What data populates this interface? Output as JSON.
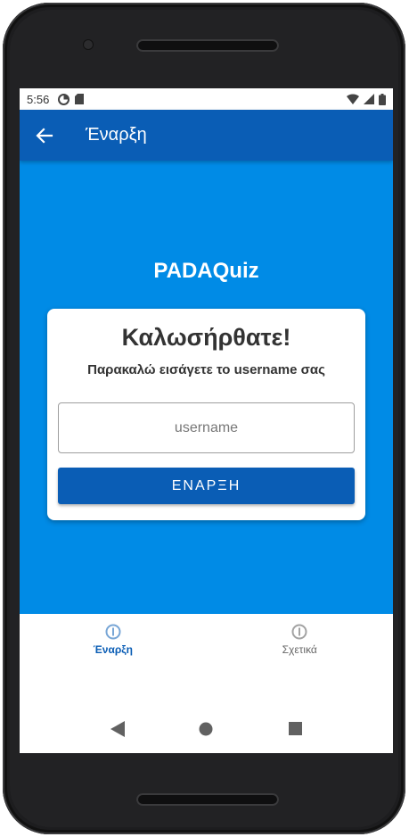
{
  "status_bar": {
    "time": "5:56"
  },
  "app_bar": {
    "title": "Έναρξη",
    "back_icon": "arrow-left-icon"
  },
  "main": {
    "app_name": "PADAQuiz",
    "card": {
      "welcome": "Καλωσήρθατε!",
      "instruction": "Παρακαλώ εισάγετε το username σας",
      "username_placeholder": "username",
      "username_value": "",
      "start_label": "ΕΝΑΡΞΗ"
    }
  },
  "bottom_nav": {
    "items": [
      {
        "label": "Έναρξη",
        "icon": "info-circle-icon",
        "active": true
      },
      {
        "label": "Σχετικά",
        "icon": "info-circle-icon",
        "active": false
      }
    ]
  },
  "colors": {
    "app_bar": "#0a5db5",
    "content_bg": "#008be6",
    "button": "#0a5db5",
    "nav_active": "#0a5db5",
    "nav_inactive": "#666666"
  }
}
